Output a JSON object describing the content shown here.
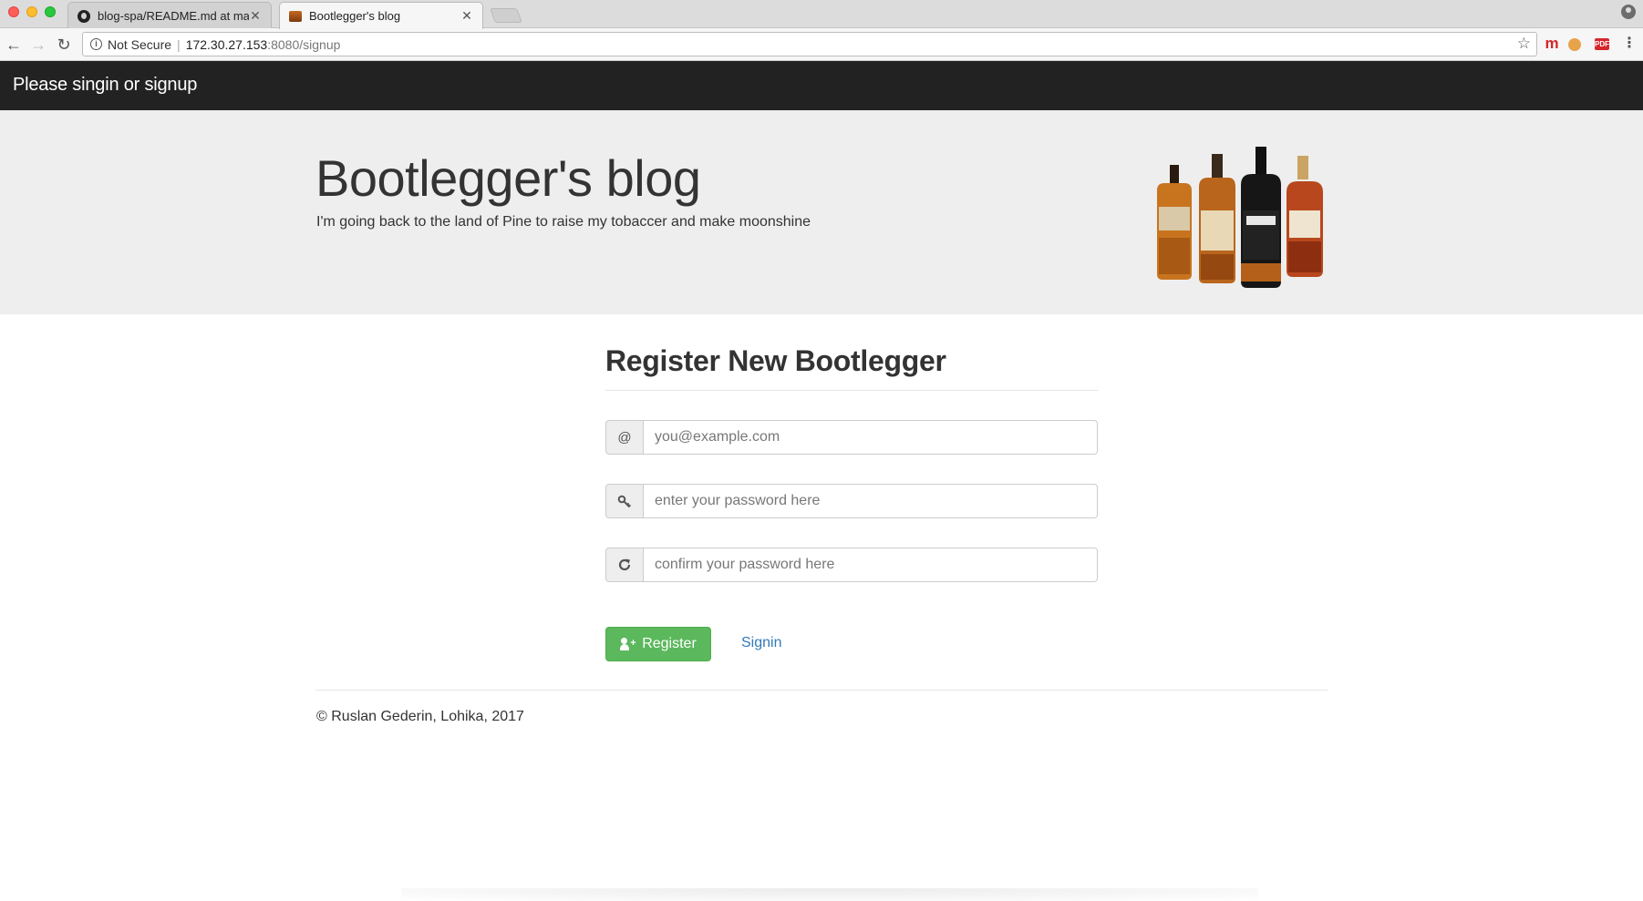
{
  "browser": {
    "tabs": [
      {
        "title": "blog-spa/README.md at mast",
        "icon": "github-icon",
        "active": false
      },
      {
        "title": "Bootlegger's blog",
        "icon": "bottle-favicon",
        "active": true
      }
    ],
    "security_label": "Not Secure",
    "url_host": "172.30.27.153",
    "url_path": ":8080/signup",
    "extensions": [
      "m",
      "cookie",
      "PDF",
      "⋮"
    ]
  },
  "navbar": {
    "brand": "Please singin or signup"
  },
  "jumbotron": {
    "title": "Bootlegger's blog",
    "subtitle": "I'm going back to the land of Pine to raise my tobaccer and make moonshine"
  },
  "form": {
    "title": "Register New Bootlegger",
    "email": {
      "addon": "@",
      "placeholder": "you@example.com",
      "value": ""
    },
    "password": {
      "addon_icon": "key-icon",
      "placeholder": "enter your password here",
      "value": ""
    },
    "confirm": {
      "addon_icon": "refresh-icon",
      "placeholder": "confirm your password here",
      "value": ""
    },
    "register_label": "Register",
    "signin_label": "Signin"
  },
  "footer": {
    "text": "© Ruslan Gederin, Lohika, 2017"
  },
  "colors": {
    "navbar_bg": "#222222",
    "jumbotron_bg": "#eeeeee",
    "success": "#5cb85c",
    "link": "#337ab7"
  }
}
